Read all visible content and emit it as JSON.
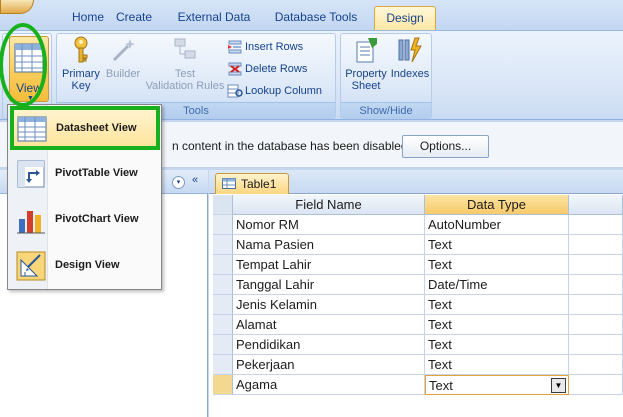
{
  "ribbon_tabs": [
    {
      "label": "Home"
    },
    {
      "label": "Create"
    },
    {
      "label": "External Data"
    },
    {
      "label": "Database Tools"
    },
    {
      "label": "Design",
      "active": true
    }
  ],
  "ribbon": {
    "view_button": {
      "label": "View",
      "icon": "datasheet-view-icon"
    },
    "tools_group": {
      "label": "Tools",
      "primary_key": {
        "label_line1": "Primary",
        "label_line2": "Key",
        "icon": "key-icon"
      },
      "builder": {
        "label": "Builder",
        "icon": "wand-icon",
        "enabled": false
      },
      "test_validation": {
        "label_line1": "Test",
        "label_line2": "Validation Rules",
        "icon": "validation-icon",
        "enabled": false
      },
      "insert_rows": {
        "label": "Insert Rows",
        "icon": "insert-rows-icon"
      },
      "delete_rows": {
        "label": "Delete Rows",
        "icon": "delete-rows-icon"
      },
      "lookup_column": {
        "label": "Lookup Column",
        "icon": "lookup-column-icon"
      }
    },
    "show_hide_group": {
      "label": "Show/Hide",
      "property_sheet": {
        "label_line1": "Property",
        "label_line2": "Sheet",
        "icon": "property-sheet-icon"
      },
      "indexes": {
        "label": "Indexes",
        "icon": "indexes-icon"
      }
    }
  },
  "message_bar": {
    "text": "n content in the database has been disabled",
    "options_label": "Options..."
  },
  "view_menu": {
    "items": [
      {
        "label": "Datasheet View",
        "icon": "datasheet-view-icon",
        "hovered": true
      },
      {
        "label": "PivotTable View",
        "icon": "pivottable-view-icon"
      },
      {
        "label": "PivotChart View",
        "icon": "pivotchart-view-icon"
      },
      {
        "label": "Design View",
        "icon": "design-view-icon"
      }
    ]
  },
  "nav_pane": {
    "dropdown_glyph": "▾",
    "collapse_glyph": "«"
  },
  "document": {
    "tab_label": "Table1",
    "columns": {
      "field_name": "Field Name",
      "data_type": "Data Type"
    },
    "rows": [
      {
        "field": "Nomor RM",
        "type": "AutoNumber"
      },
      {
        "field": "Nama Pasien",
        "type": "Text"
      },
      {
        "field": "Tempat Lahir",
        "type": "Text"
      },
      {
        "field": "Tanggal Lahir",
        "type": "Date/Time"
      },
      {
        "field": "Jenis Kelamin",
        "type": "Text"
      },
      {
        "field": "Alamat",
        "type": "Text"
      },
      {
        "field": "Pendidikan",
        "type": "Text"
      },
      {
        "field": "Pekerjaan",
        "type": "Text"
      },
      {
        "field": "Agama",
        "type": "Text",
        "active": true
      }
    ]
  },
  "colors": {
    "annotation_green": "#19b01e",
    "ribbon_blue": "#15428b",
    "active_tab": "#fde7a5"
  }
}
